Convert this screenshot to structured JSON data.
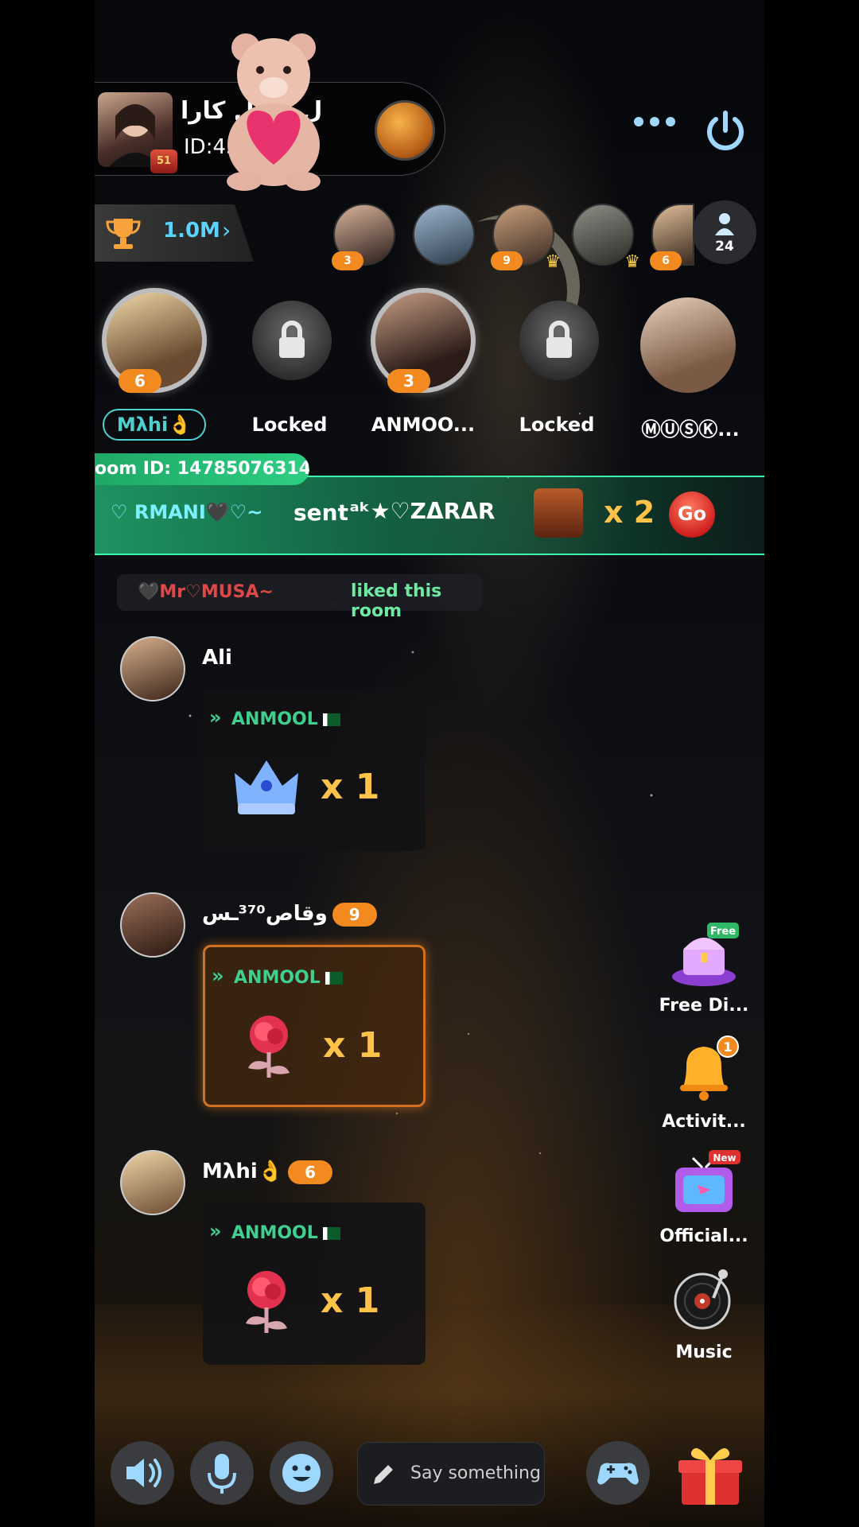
{
  "room": {
    "name": "ل کـ ـل کارا",
    "id_text": "ID:43   0",
    "level_badge": "51"
  },
  "rank": {
    "value": "1.0M",
    "arrow": "›"
  },
  "viewers": [
    {
      "badge": "3",
      "crown": false
    },
    {
      "badge": "",
      "crown": false
    },
    {
      "badge": "9",
      "crown": true
    },
    {
      "badge": "",
      "crown": true
    },
    {
      "badge": "6",
      "crown": false
    }
  ],
  "viewer_count": "24",
  "seats": [
    {
      "label": "Mλhi👌",
      "badge": "6",
      "type": "user"
    },
    {
      "label": "Locked",
      "type": "locked"
    },
    {
      "label": "ANMOO...",
      "badge": "3",
      "type": "user"
    },
    {
      "label": "Locked",
      "type": "locked"
    },
    {
      "label": "ⓂⓊⓈⓀ...",
      "type": "user"
    }
  ],
  "marquee": {
    "text": "oom ID: 14785076314]"
  },
  "banner": {
    "sender": "♡ RMANI🖤♡~",
    "sent_label": "sent",
    "recipient": "ᵃᵏ★♡ZΔRΔR",
    "quantity": "x 2",
    "go_label": "Go"
  },
  "liked": {
    "user": "🖤Mr♡MUSA~",
    "text": "liked this room"
  },
  "messages": [
    {
      "name": "Ali",
      "recipient": "ANMOOL",
      "quantity": "x 1",
      "gift": "crown"
    },
    {
      "name": "وقاص³⁷⁰ـس",
      "level": "9",
      "recipient": "ANMOOL",
      "quantity": "x 1",
      "gift": "rose"
    },
    {
      "name": "Mλhi👌",
      "level": "6",
      "recipient": "ANMOOL",
      "quantity": "x 1",
      "gift": "rose"
    }
  ],
  "side_actions": [
    {
      "label": "Free Di...",
      "icon": "treasure-chest-icon",
      "badge": "Free"
    },
    {
      "label": "Activit...",
      "icon": "bell-icon",
      "badge": "1"
    },
    {
      "label": "Official...",
      "icon": "tv-icon",
      "badge": "New"
    },
    {
      "label": "Music",
      "icon": "vinyl-record-icon"
    }
  ],
  "input": {
    "placeholder": "Say something"
  },
  "icons": {
    "more": "ellipsis-icon",
    "power": "power-icon",
    "speaker": "speaker-icon",
    "mic": "microphone-icon",
    "emoji": "emoji-icon",
    "game": "gamepad-icon",
    "gift": "gift-box-icon"
  },
  "colors": {
    "accent": "#2dcf83",
    "badge": "#f28a1f",
    "gold": "#ffc34a",
    "link": "#5ad4ff"
  }
}
